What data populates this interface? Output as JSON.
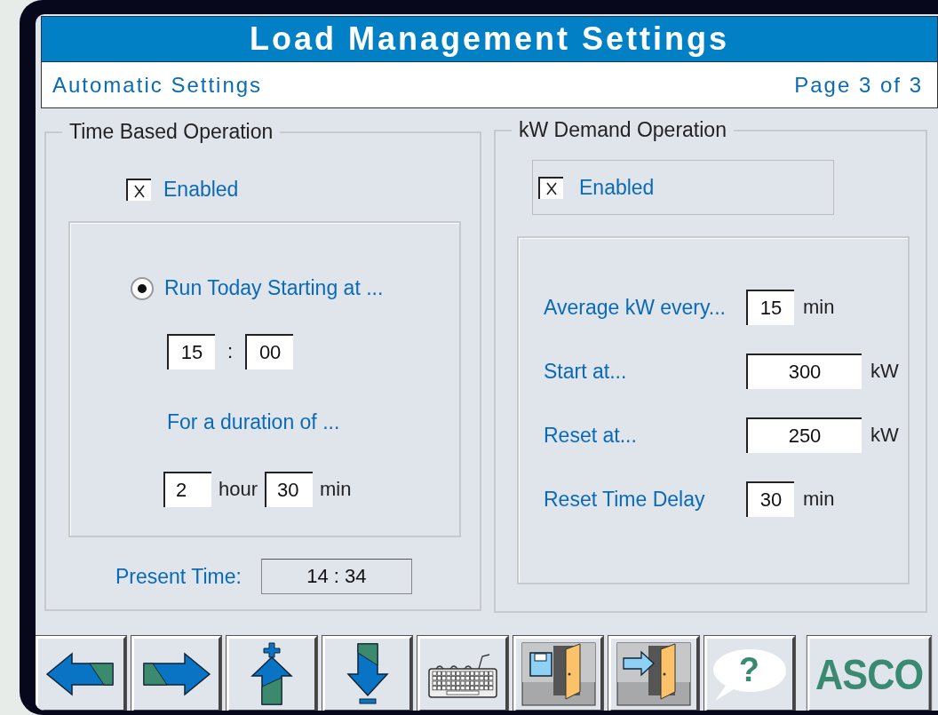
{
  "header": {
    "title": "Load Management Settings",
    "subtitle": "Automatic Settings",
    "page": "Page 3 of 3"
  },
  "time_based": {
    "legend": "Time Based Operation",
    "enabled": {
      "label": "Enabled",
      "checked": true
    },
    "run_today": {
      "label": "Run Today Starting at ...",
      "selected": true
    },
    "start_hour": "15",
    "separator": ":",
    "start_minute": "00",
    "duration_label": "For a duration of ...",
    "duration_hours": "2",
    "hours_unit": "hour",
    "duration_minutes": "30",
    "minutes_unit": "min",
    "present_time_label": "Present Time:",
    "present_time": "14 : 34"
  },
  "kw_demand": {
    "legend": "kW Demand Operation",
    "enabled": {
      "label": "Enabled",
      "checked": true
    },
    "rows": [
      {
        "label": "Average kW every...",
        "value": "15",
        "unit": "min",
        "kind": "short"
      },
      {
        "label": "Start at...",
        "value": "300",
        "unit": "kW",
        "kind": "wide"
      },
      {
        "label": "Reset at...",
        "value": "250",
        "unit": "kW",
        "kind": "wide"
      },
      {
        "label": "Reset Time Delay",
        "value": "30",
        "unit": "min",
        "kind": "short"
      }
    ]
  },
  "toolbar": [
    {
      "kind": "back"
    },
    {
      "kind": "forward"
    },
    {
      "kind": "up"
    },
    {
      "kind": "down"
    },
    {
      "kind": "keyboard"
    },
    {
      "kind": "save_exit"
    },
    {
      "kind": "exit"
    },
    {
      "kind": "help",
      "glyph": "?"
    },
    {
      "kind": "logo",
      "text": "ASCO"
    }
  ]
}
